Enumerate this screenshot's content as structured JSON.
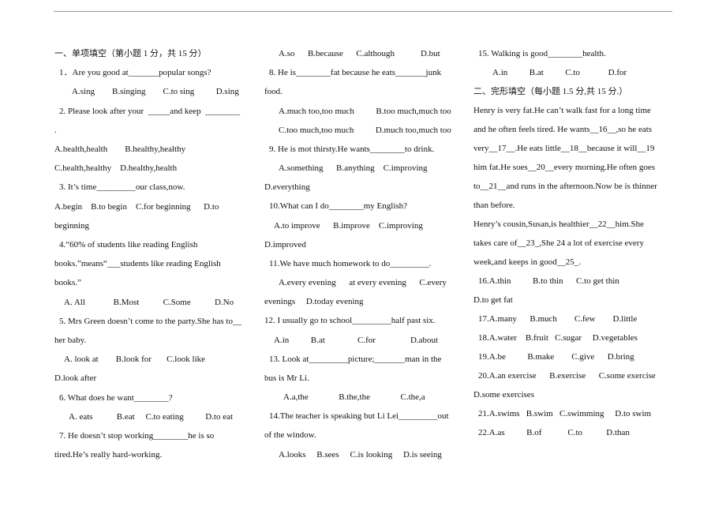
{
  "document": {
    "columns": [
      {
        "name": "column-left",
        "lines": [
          "一、单项填空（第小题 1 分，共 15 分）",
          "1．Are you good at_______popular songs?",
          "A.sing        B.singing        C.to sing          D.sing",
          "2. Please look after your  _____and keep  ________",
          ".",
          "A.health,health        B.healthy,healthy",
          "C.health,healthy    D.healthy,health",
          "3. It’s time_________our class,now.",
          "A.begin    B.to begin    C.for beginning      D.to",
          "beginning",
          "4.“60% of students like reading English",
          "books.”means“___students like reading English",
          "books.”",
          "A. All             B.Most           C.Some           D.No",
          "5. Mrs Green doesn’t come to the party.She has to__",
          "her baby.",
          "A. look at        B.look for       C.look like",
          "D.look after",
          "6. What does he want________?",
          "A. eats           B.eat     C.to eating          D.to eat",
          "7. He doesn’t stop working________he is so",
          "tired.He’s really hard-working."
        ]
      },
      {
        "name": "column-middle",
        "lines": [
          "A.so      B.because      C.although            D.but",
          "8. He is________fat because he eats_______junk",
          "food.",
          "A.much too,too much          B.too much,much too",
          "C.too much,too much          D.much too,much too",
          "9. He is mot thirsty.He wants________to drink.",
          "A.something      B.anything    C.improving",
          "D.everything",
          "10.What can I do________my English?",
          "A.to improve      B.improve    C.improving",
          "D.improved",
          "11.We have much homework to do_________.",
          "A.every evening      at every evening      C.every",
          "evenings     D.today evening",
          "12. I usually go to school_________half past six.",
          "A.in          B.at               C.for                D.about",
          "13. Look at_________picture;_______man in the",
          "bus is Mr Li.",
          "A.a,the              B.the,the              C.the,a",
          "14.The teacher is speaking but Li Lei_________out",
          "of the window.",
          "A.looks     B.sees     C.is looking     D.is seeing"
        ]
      },
      {
        "name": "column-right",
        "lines": [
          "15. Walking is good________health.",
          "A.in          B.at          C.to             D.for",
          "二、完形填空（每小题 1.5 分,共 15 分.）",
          "Henry is very fat.He can’t walk fast for a long time",
          "and he often feels tired. He wants__16__,so he eats",
          "very__17__.He eats little__18__because it will__19",
          "him fat.He soes__20__every morning.He often goes",
          "to__21__and runs in the afternoon.Now be is thinner",
          "than before.",
          "Henry’s cousin,Susan,is healthier__22__him.She",
          "takes care of__23_,She 24 a lot of exercise every",
          "week,and keeps in good__25_.",
          "16.A.thin          B.to thin      C.to get thin",
          "D.to get fat",
          "17.A.many      B.much        C.few        D.little",
          "18.A.water    B.fruit   C.sugar     D.vegetables",
          "19.A.be          B.make        C.give      D.bring",
          "20.A.an exercise      B.exercise      C.some exercise",
          "D.some exercises",
          "21.A.swims   B.swim   C.swimming     D.to swim",
          "22.A.as          B.of            C.to           D.than"
        ]
      }
    ]
  }
}
